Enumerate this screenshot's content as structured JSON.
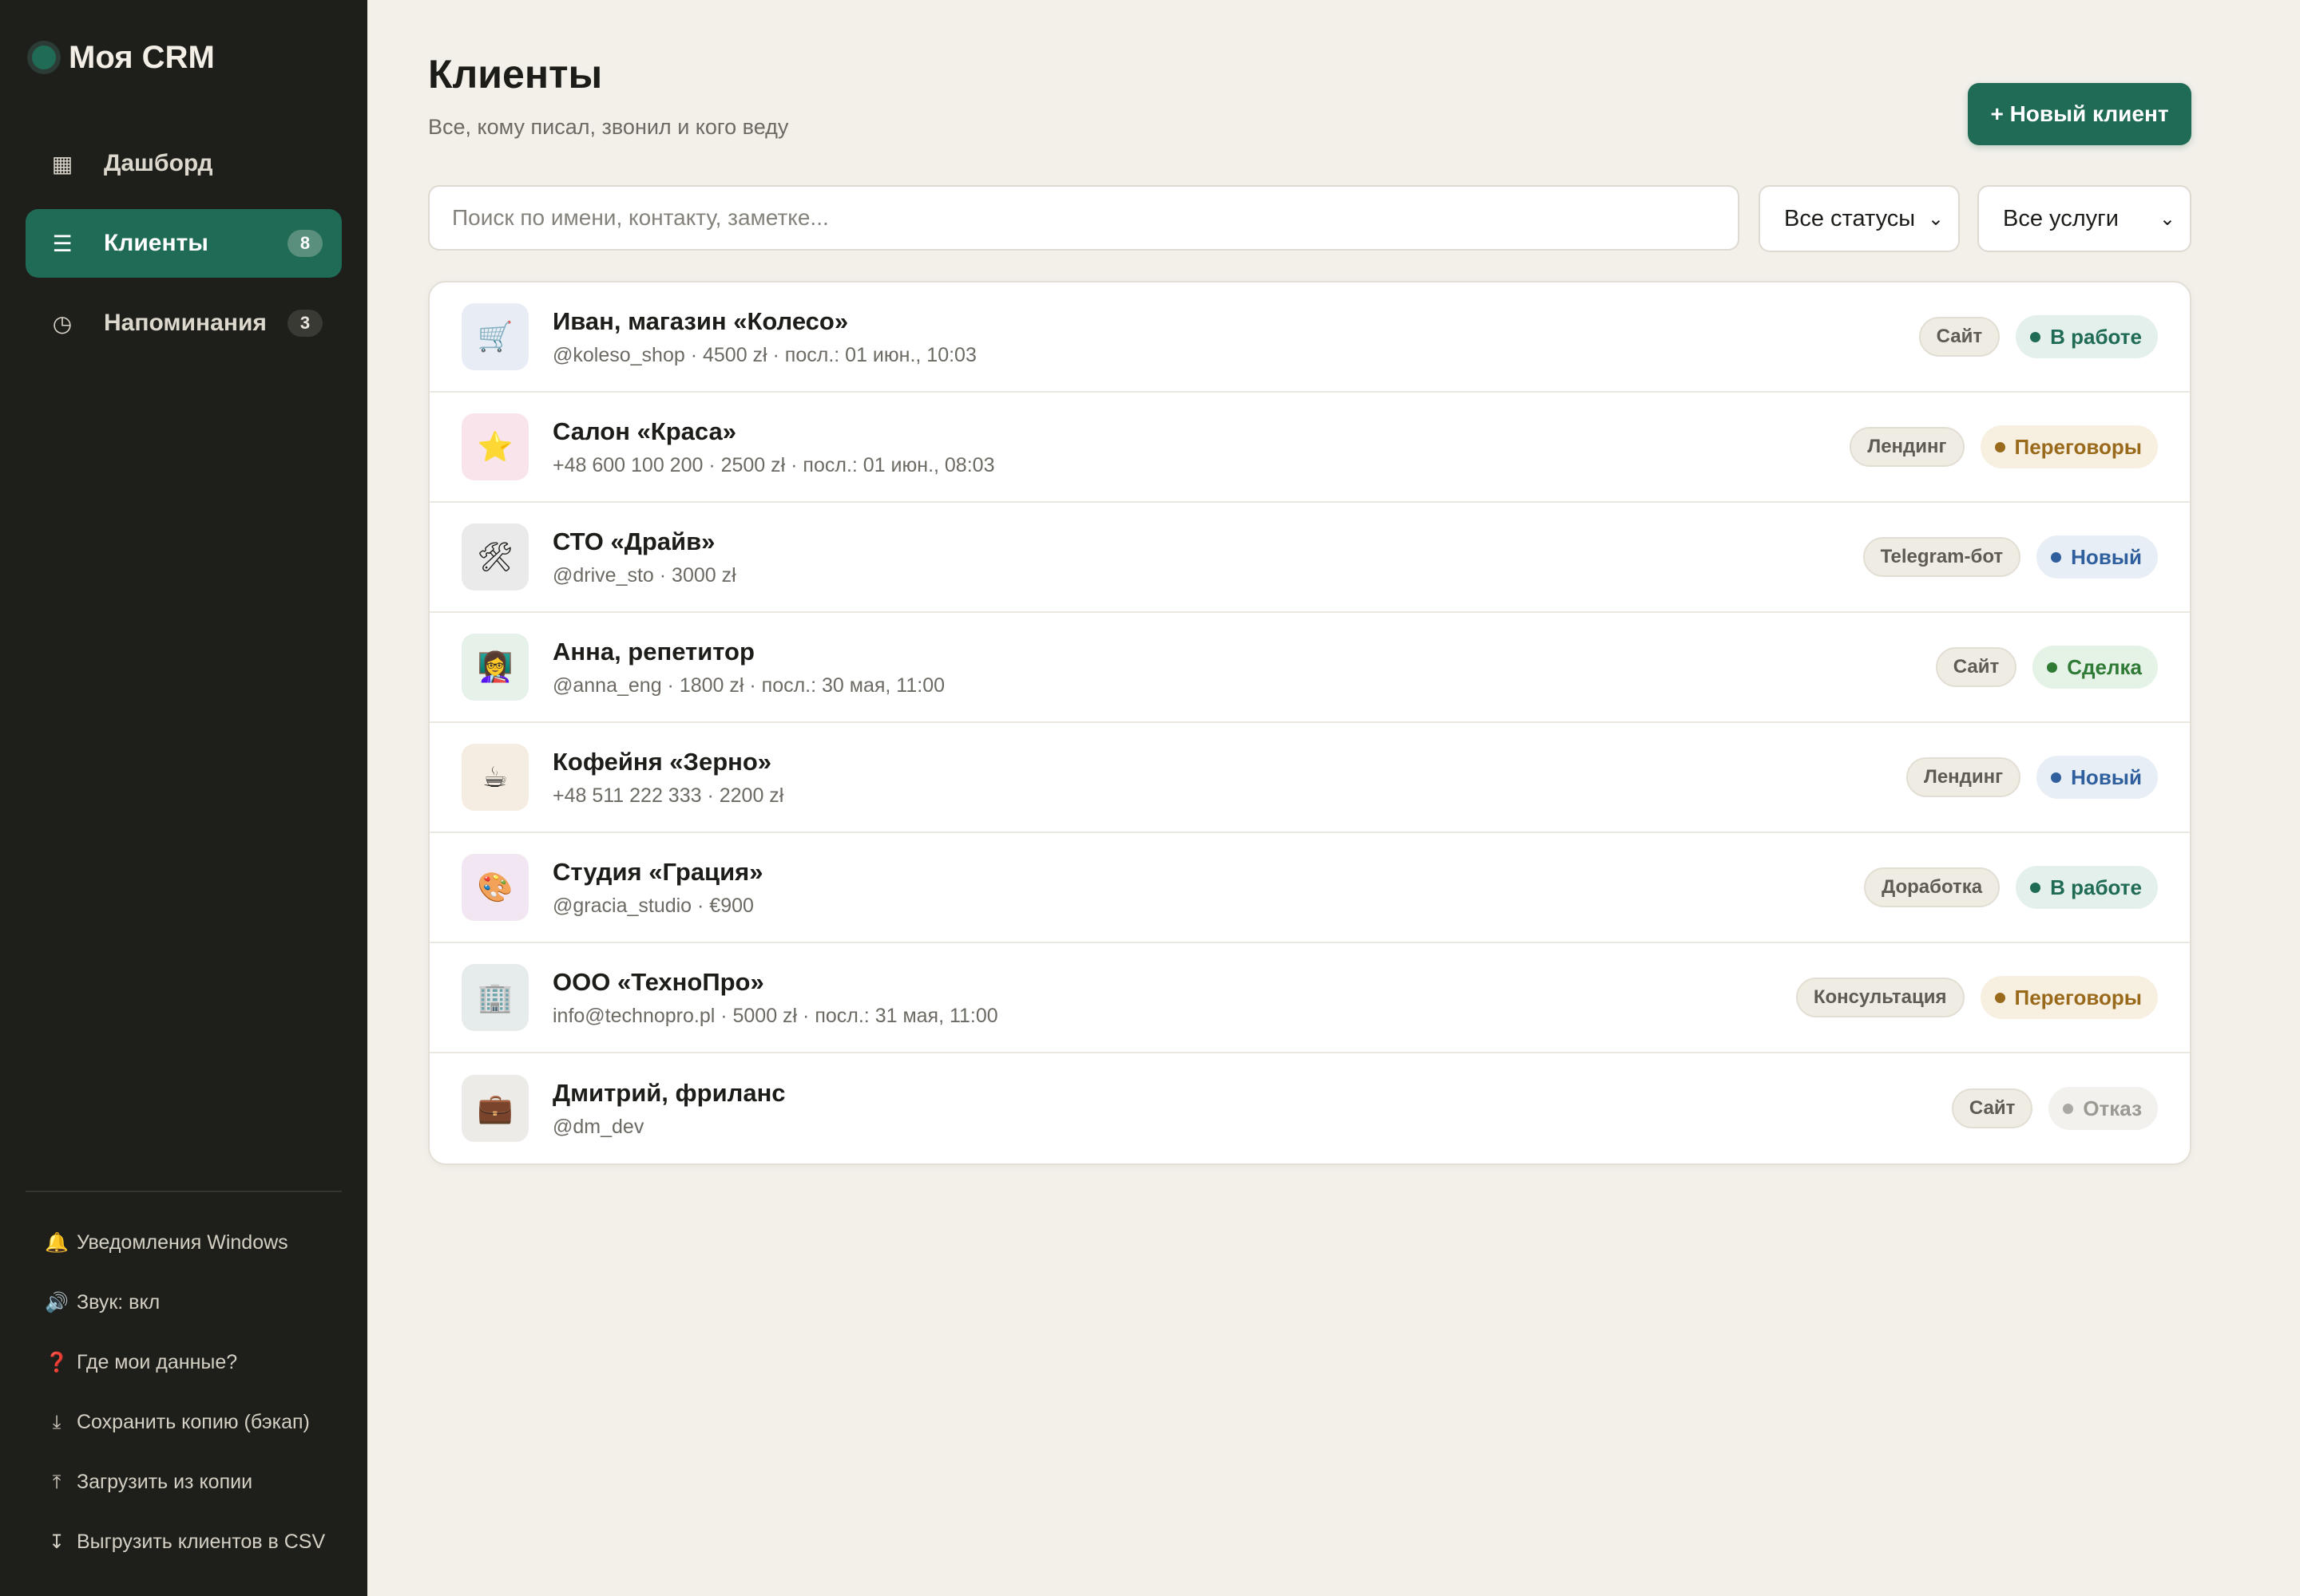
{
  "app": {
    "title": "Моя CRM"
  },
  "sidebar": {
    "nav": [
      {
        "label": "Дашборд",
        "icon": "grid-icon",
        "glyph": "▦",
        "badge": null,
        "active": false
      },
      {
        "label": "Клиенты",
        "icon": "list-icon",
        "glyph": "☰",
        "badge": "8",
        "active": true
      },
      {
        "label": "Напоминания",
        "icon": "clock-icon",
        "glyph": "◷",
        "badge": "3",
        "active": false
      }
    ],
    "actions": [
      {
        "label": "Уведомления Windows",
        "icon": "bell-icon",
        "glyph": "🔔"
      },
      {
        "label": "Звук: вкл",
        "icon": "speaker-icon",
        "glyph": "🔊"
      },
      {
        "label": "Где мои данные?",
        "icon": "question-icon",
        "glyph": "❓"
      },
      {
        "label": "Сохранить копию (бэкап)",
        "icon": "download-icon",
        "glyph": "⤓"
      },
      {
        "label": "Загрузить из копии",
        "icon": "upload-icon",
        "glyph": "⤒"
      },
      {
        "label": "Выгрузить клиентов в CSV",
        "icon": "export-icon",
        "glyph": "↧"
      }
    ]
  },
  "main": {
    "title": "Клиенты",
    "subtitle": "Все, кому писал, звонил и кого веду",
    "new_button": "+ Новый клиент",
    "search": {
      "placeholder": "Поиск по имени, контакту, заметке...",
      "value": ""
    },
    "filters": {
      "status": "Все статусы",
      "service": "Все услуги"
    }
  },
  "clients": [
    {
      "name": "Иван, магазин «Колесо»",
      "meta": "@koleso_shop · 4500 zł · посл.: 01 июн., 10:03",
      "service": "Сайт",
      "status": "В работе",
      "status_kind": "work",
      "icon": "cart-icon",
      "glyph": "🛒",
      "avatar_bg": "#e8edf5"
    },
    {
      "name": "Салон «Краса»",
      "meta": "+48 600 100 200 · 2500 zł · посл.: 01 июн., 08:03",
      "service": "Лендинг",
      "status": "Переговоры",
      "status_kind": "neg",
      "icon": "star-icon",
      "glyph": "⭐",
      "avatar_bg": "#f8e4ea"
    },
    {
      "name": "СТО «Драйв»",
      "meta": "@drive_sto · 3000 zł",
      "service": "Telegram-бот",
      "status": "Новый",
      "status_kind": "new",
      "icon": "tools-icon",
      "glyph": "🛠",
      "avatar_bg": "#e9eae9"
    },
    {
      "name": "Анна, репетитор",
      "meta": "@anna_eng · 1800 zł · посл.: 30 мая, 11:00",
      "service": "Сайт",
      "status": "Сделка",
      "status_kind": "deal",
      "icon": "teacher-icon",
      "glyph": "👩‍🏫",
      "avatar_bg": "#e6f1e9"
    },
    {
      "name": "Кофейня «Зерно»",
      "meta": "+48 511 222 333 · 2200 zł",
      "service": "Лендинг",
      "status": "Новый",
      "status_kind": "new",
      "icon": "coffee-icon",
      "glyph": "☕",
      "avatar_bg": "#f5ede1"
    },
    {
      "name": "Студия «Грация»",
      "meta": "@gracia_studio · €900",
      "service": "Доработка",
      "status": "В работе",
      "status_kind": "work",
      "icon": "palette-icon",
      "glyph": "🎨",
      "avatar_bg": "#f1e6f1"
    },
    {
      "name": "ООО «ТехноПро»",
      "meta": "info@technopro.pl · 5000 zł · посл.: 31 мая, 11:00",
      "service": "Консультация",
      "status": "Переговоры",
      "status_kind": "neg",
      "icon": "office-building-icon",
      "glyph": "🏢",
      "avatar_bg": "#e6ecec"
    },
    {
      "name": "Дмитрий, фриланс",
      "meta": "@dm_dev",
      "service": "Сайт",
      "status": "Отказ",
      "status_kind": "rej",
      "icon": "briefcase-icon",
      "glyph": "💼",
      "avatar_bg": "#ecebe8"
    }
  ]
}
